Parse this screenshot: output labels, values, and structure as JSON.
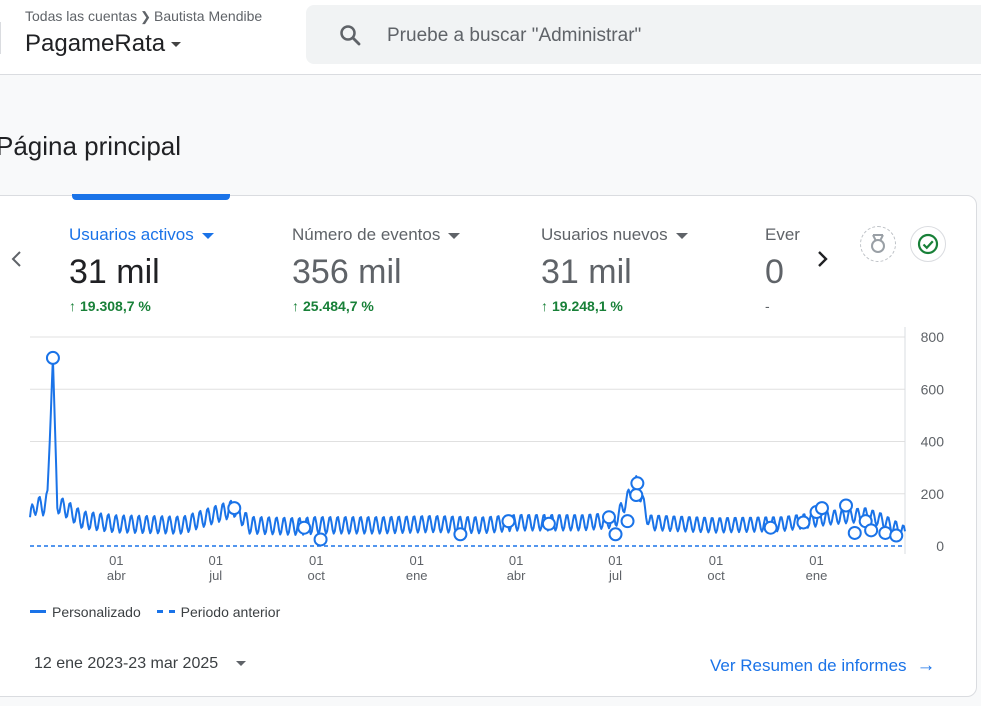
{
  "header": {
    "breadcrumb_root": "Todas las cuentas",
    "breadcrumb_account": "Bautista Mendibe",
    "property_name": "PagameRata",
    "search_placeholder": "Pruebe a buscar \"Administrar\""
  },
  "page": {
    "title": "Página principal"
  },
  "metrics": [
    {
      "label": "Usuarios activos",
      "value": "31 mil",
      "change": "19.308,7 %",
      "active": true
    },
    {
      "label": "Número de eventos",
      "value": "356 mil",
      "change": "25.484,7 %",
      "active": false
    },
    {
      "label": "Usuarios nuevos",
      "value": "31 mil",
      "change": "19.248,1 %",
      "active": false
    },
    {
      "label": "Ever",
      "value": "0",
      "change": "-",
      "active": false
    }
  ],
  "icons": {
    "prev": "chevron-left-icon",
    "next": "chevron-right-icon",
    "insights": "insights-badge-icon",
    "status": "check-circle-icon",
    "search": "search-icon",
    "up_arrow": "arrow-up-icon",
    "link_arrow": "arrow-right-icon"
  },
  "colors": {
    "accent": "#1a73e8",
    "positive": "#188038",
    "text": "#202124",
    "muted": "#5f6368"
  },
  "chart_data": {
    "type": "line",
    "ylim": [
      0,
      800
    ],
    "y_ticks": [
      "800",
      "600",
      "400",
      "200",
      "0"
    ],
    "x_ticks": [
      {
        "day": "01",
        "month": "abr"
      },
      {
        "day": "01",
        "month": "jul"
      },
      {
        "day": "01",
        "month": "oct"
      },
      {
        "day": "01",
        "month": "ene"
      },
      {
        "day": "01",
        "month": "abr"
      },
      {
        "day": "01",
        "month": "jul"
      },
      {
        "day": "01",
        "month": "oct"
      },
      {
        "day": "01",
        "month": "ene"
      }
    ],
    "x_range": [
      "2023-01-12",
      "2025-03-23"
    ],
    "series": [
      {
        "name": "Personalizado",
        "style": "solid",
        "points": [
          [
            "2023-01-12",
            110
          ],
          [
            "2023-01-18",
            160
          ],
          [
            "2023-01-24",
            150
          ],
          [
            "2023-01-28",
            180
          ],
          [
            "2023-02-02",
            720
          ],
          [
            "2023-02-06",
            160
          ],
          [
            "2023-02-15",
            140
          ],
          [
            "2023-03-01",
            100
          ],
          [
            "2023-04-01",
            85
          ],
          [
            "2023-06-01",
            80
          ],
          [
            "2023-07-18",
            145
          ],
          [
            "2023-08-01",
            80
          ],
          [
            "2023-09-15",
            75
          ],
          [
            "2023-10-01",
            80
          ],
          [
            "2023-12-01",
            80
          ],
          [
            "2024-01-15",
            85
          ],
          [
            "2024-03-01",
            80
          ],
          [
            "2024-04-01",
            90
          ],
          [
            "2024-06-01",
            90
          ],
          [
            "2024-07-01",
            100
          ],
          [
            "2024-07-20",
            240
          ],
          [
            "2024-08-01",
            90
          ],
          [
            "2024-10-01",
            80
          ],
          [
            "2024-12-01",
            85
          ],
          [
            "2025-01-15",
            110
          ],
          [
            "2025-02-15",
            120
          ],
          [
            "2025-03-01",
            100
          ],
          [
            "2025-03-23",
            50
          ]
        ]
      },
      {
        "name": "Periodo anterior",
        "style": "dashed",
        "points": [
          [
            "2023-01-12",
            0
          ],
          [
            "2025-03-23",
            0
          ]
        ]
      }
    ],
    "markers": [
      [
        "2023-02-02",
        720
      ],
      [
        "2023-07-18",
        145
      ],
      [
        "2023-09-20",
        70
      ],
      [
        "2023-10-05",
        25
      ],
      [
        "2024-02-10",
        45
      ],
      [
        "2024-03-25",
        95
      ],
      [
        "2024-05-01",
        85
      ],
      [
        "2024-06-25",
        110
      ],
      [
        "2024-07-01",
        45
      ],
      [
        "2024-07-12",
        95
      ],
      [
        "2024-07-20",
        195
      ],
      [
        "2024-07-21",
        240
      ],
      [
        "2024-11-20",
        70
      ],
      [
        "2024-12-20",
        90
      ],
      [
        "2025-01-01",
        130
      ],
      [
        "2025-01-06",
        145
      ],
      [
        "2025-01-28",
        155
      ],
      [
        "2025-02-05",
        50
      ],
      [
        "2025-02-15",
        95
      ],
      [
        "2025-02-20",
        60
      ],
      [
        "2025-03-05",
        50
      ],
      [
        "2025-03-15",
        40
      ]
    ],
    "grid": true,
    "legend_position": "bottom-left"
  },
  "footer": {
    "date_range": "12 ene 2023-23 mar 2025",
    "report_link": "Ver Resumen de informes"
  }
}
